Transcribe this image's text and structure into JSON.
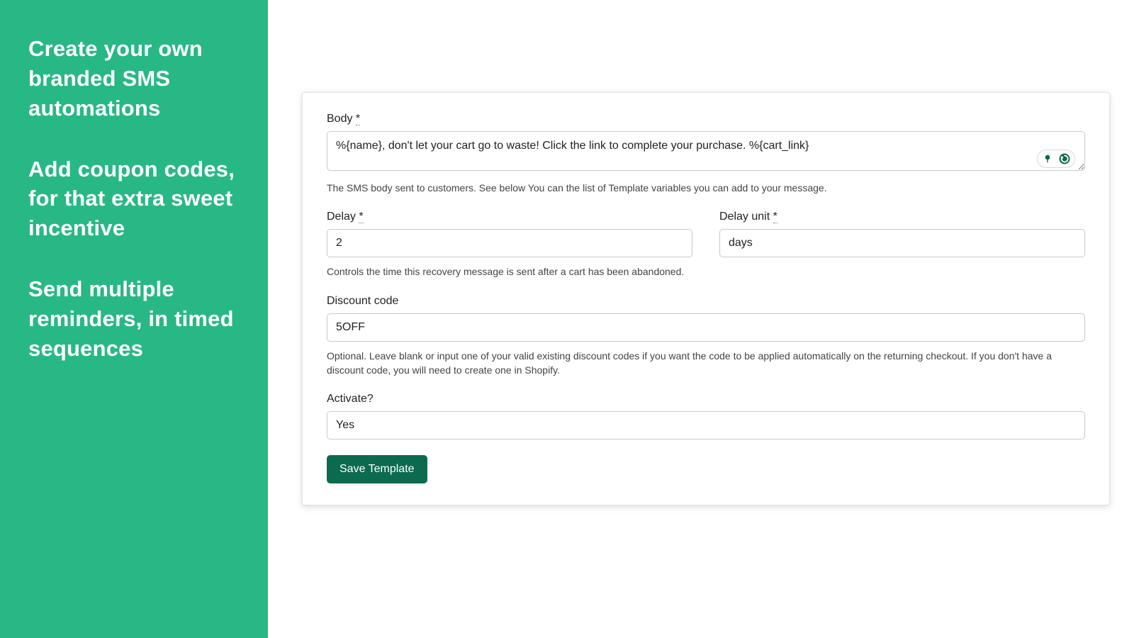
{
  "promo": {
    "p1": "Create your own branded SMS automations",
    "p2": "Add coupon codes, for that extra sweet incentive",
    "p3": "Send multiple reminders, in timed sequences"
  },
  "form": {
    "body": {
      "label": "Body",
      "required_marker": "*",
      "value": "%{name}, don't let your cart go to waste! Click the link to complete your purchase. %{cart_link}",
      "help": "The SMS body sent to customers. See below You can the list of Template variables you can add to your message."
    },
    "delay": {
      "label": "Delay",
      "required_marker": "*",
      "value": "2"
    },
    "delay_unit": {
      "label": "Delay unit",
      "required_marker": "*",
      "value": "days"
    },
    "delay_help": "Controls the time this recovery message is sent after a cart has been abandoned.",
    "discount": {
      "label": "Discount code",
      "value": "5OFF",
      "help": "Optional. Leave blank or input one of your valid existing discount codes if you want the code to be applied automatically on the returning checkout. If you don't have a discount code, you will need to create one in Shopify."
    },
    "activate": {
      "label": "Activate?",
      "value": "Yes"
    },
    "save_label": "Save Template"
  }
}
